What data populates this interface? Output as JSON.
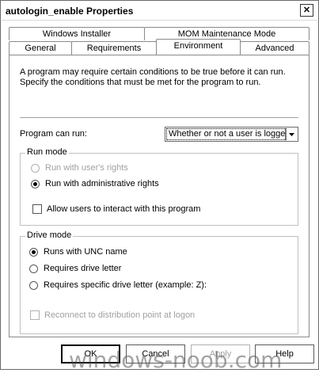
{
  "window": {
    "title": "autologin_enable Properties",
    "close_glyph": "✕"
  },
  "tabs": {
    "row1": [
      "Windows Installer",
      "MOM Maintenance Mode"
    ],
    "row2": [
      "General",
      "Requirements",
      "Environment",
      "Advanced"
    ],
    "active": "Environment"
  },
  "intro": {
    "line1": "A program may require certain conditions to be true before it can run.",
    "line2": "Specify the conditions that must be met for the program to run."
  },
  "program_can_run": {
    "label": "Program can run:",
    "selected": "Whether or not a user is logged on"
  },
  "run_mode": {
    "title": "Run mode",
    "user_rights": "Run with user's rights",
    "admin_rights": "Run with administrative rights",
    "allow_interact": "Allow users to interact with this program"
  },
  "drive_mode": {
    "title": "Drive mode",
    "unc": "Runs with UNC name",
    "drive_letter": "Requires drive letter",
    "specific_letter": "Requires specific drive letter (example: Z):",
    "reconnect": "Reconnect to distribution point at logon"
  },
  "buttons": {
    "ok": "OK",
    "cancel": "Cancel",
    "apply": "Apply",
    "help": "Help"
  },
  "watermark": "windows-noob.com"
}
